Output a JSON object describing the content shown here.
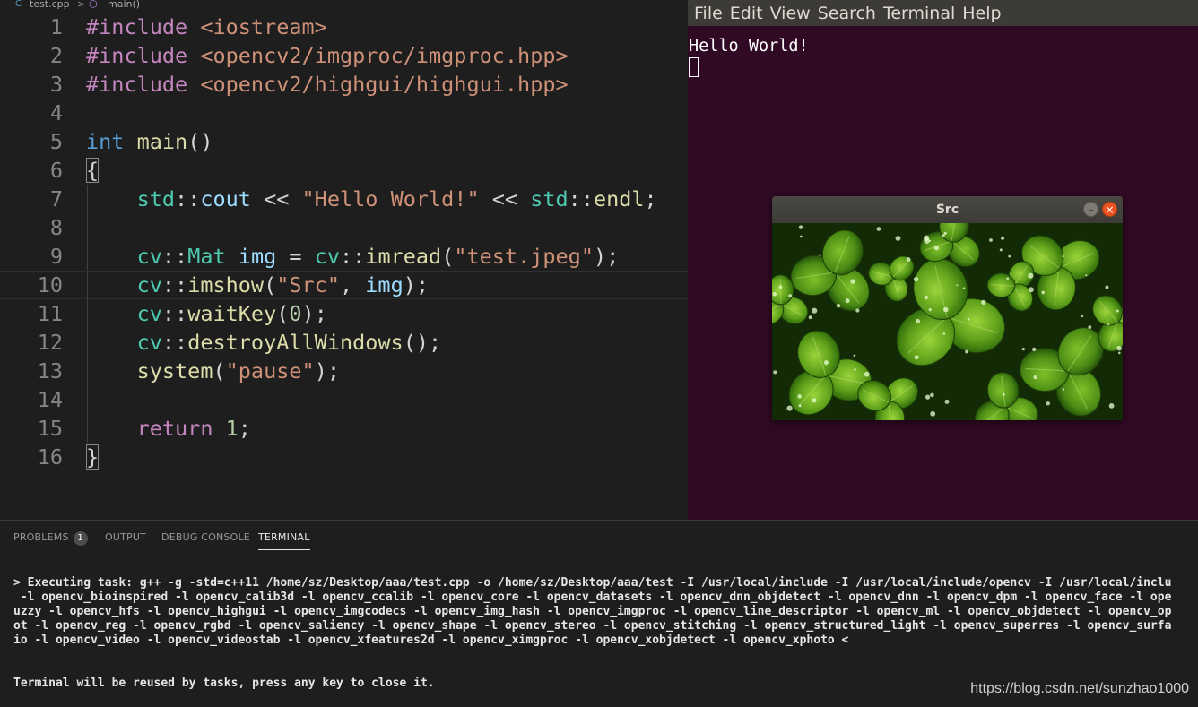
{
  "breadcrumb": {
    "file": "test.cpp",
    "separator": ">",
    "symbol": "main()"
  },
  "editor": {
    "lines": [
      {
        "n": "1",
        "tokens": [
          {
            "t": "#include",
            "c": "pp"
          },
          {
            "t": " "
          },
          {
            "t": "<iostream>",
            "c": "inc"
          }
        ]
      },
      {
        "n": "2",
        "tokens": [
          {
            "t": "#include",
            "c": "pp"
          },
          {
            "t": " "
          },
          {
            "t": "<opencv2/imgproc/imgproc.hpp>",
            "c": "inc"
          }
        ]
      },
      {
        "n": "3",
        "tokens": [
          {
            "t": "#include",
            "c": "pp"
          },
          {
            "t": " "
          },
          {
            "t": "<opencv2/highgui/highgui.hpp>",
            "c": "inc"
          }
        ]
      },
      {
        "n": "4",
        "tokens": []
      },
      {
        "n": "5",
        "tokens": [
          {
            "t": "int",
            "c": "kw"
          },
          {
            "t": " "
          },
          {
            "t": "main",
            "c": "fn"
          },
          {
            "t": "()",
            "c": "def"
          }
        ]
      },
      {
        "n": "6",
        "tokens": [
          {
            "t": "{",
            "c": "brace"
          }
        ]
      },
      {
        "n": "7",
        "tokens": [
          {
            "t": "    "
          },
          {
            "t": "std",
            "c": "ns"
          },
          {
            "t": "::",
            "c": "def"
          },
          {
            "t": "cout",
            "c": "var"
          },
          {
            "t": " << ",
            "c": "op"
          },
          {
            "t": "\"Hello World!\"",
            "c": "str"
          },
          {
            "t": " << ",
            "c": "op"
          },
          {
            "t": "std",
            "c": "ns"
          },
          {
            "t": "::",
            "c": "def"
          },
          {
            "t": "endl",
            "c": "fn"
          },
          {
            "t": ";",
            "c": "def"
          }
        ]
      },
      {
        "n": "8",
        "tokens": []
      },
      {
        "n": "9",
        "tokens": [
          {
            "t": "    "
          },
          {
            "t": "cv",
            "c": "ns"
          },
          {
            "t": "::",
            "c": "def"
          },
          {
            "t": "Mat",
            "c": "ty"
          },
          {
            "t": " "
          },
          {
            "t": "img",
            "c": "var"
          },
          {
            "t": " = ",
            "c": "op"
          },
          {
            "t": "cv",
            "c": "ns"
          },
          {
            "t": "::",
            "c": "def"
          },
          {
            "t": "imread",
            "c": "fn"
          },
          {
            "t": "(",
            "c": "def"
          },
          {
            "t": "\"test.jpeg\"",
            "c": "str"
          },
          {
            "t": ");",
            "c": "def"
          }
        ]
      },
      {
        "n": "10",
        "current": true,
        "tokens": [
          {
            "t": "    "
          },
          {
            "t": "cv",
            "c": "ns"
          },
          {
            "t": "::",
            "c": "def"
          },
          {
            "t": "imshow",
            "c": "fn"
          },
          {
            "t": "(",
            "c": "def"
          },
          {
            "t": "\"Src\"",
            "c": "str"
          },
          {
            "t": ", ",
            "c": "def"
          },
          {
            "t": "img",
            "c": "var"
          },
          {
            "t": ");",
            "c": "def"
          }
        ]
      },
      {
        "n": "11",
        "tokens": [
          {
            "t": "    "
          },
          {
            "t": "cv",
            "c": "ns"
          },
          {
            "t": "::",
            "c": "def"
          },
          {
            "t": "waitKey",
            "c": "fn"
          },
          {
            "t": "(",
            "c": "def"
          },
          {
            "t": "0",
            "c": "num"
          },
          {
            "t": ");",
            "c": "def"
          }
        ]
      },
      {
        "n": "12",
        "tokens": [
          {
            "t": "    "
          },
          {
            "t": "cv",
            "c": "ns"
          },
          {
            "t": "::",
            "c": "def"
          },
          {
            "t": "destroyAllWindows",
            "c": "fn"
          },
          {
            "t": "();",
            "c": "def"
          }
        ]
      },
      {
        "n": "13",
        "tokens": [
          {
            "t": "    "
          },
          {
            "t": "system",
            "c": "fn"
          },
          {
            "t": "(",
            "c": "def"
          },
          {
            "t": "\"pause\"",
            "c": "str"
          },
          {
            "t": ");",
            "c": "def"
          }
        ]
      },
      {
        "n": "14",
        "tokens": []
      },
      {
        "n": "15",
        "tokens": [
          {
            "t": "    "
          },
          {
            "t": "return",
            "c": "ctl"
          },
          {
            "t": " "
          },
          {
            "t": "1",
            "c": "num"
          },
          {
            "t": ";",
            "c": "def"
          }
        ]
      },
      {
        "n": "16",
        "tokens": [
          {
            "t": "}",
            "c": "brace"
          }
        ]
      }
    ]
  },
  "terminal_window": {
    "menu": [
      "File",
      "Edit",
      "View",
      "Search",
      "Terminal",
      "Help"
    ],
    "output": [
      "Hello World!"
    ]
  },
  "image_window": {
    "title": "Src",
    "minimize_glyph": "–",
    "close_glyph": "×"
  },
  "panel": {
    "tabs": [
      {
        "label": "PROBLEMS",
        "badge": "1"
      },
      {
        "label": "OUTPUT"
      },
      {
        "label": "DEBUG CONSOLE"
      },
      {
        "label": "TERMINAL",
        "active": true
      }
    ],
    "output_lines": [
      "> Executing task: g++ -g -std=c++11 /home/sz/Desktop/aaa/test.cpp -o /home/sz/Desktop/aaa/test -I /usr/local/include -I /usr/local/include/opencv -I /usr/local/inclu",
      " -l opencv_bioinspired -l opencv_calib3d -l opencv_ccalib -l opencv_core -l opencv_datasets -l opencv_dnn_objdetect -l opencv_dnn -l opencv_dpm -l opencv_face -l ope",
      "uzzy -l opencv_hfs -l opencv_highgui -l opencv_imgcodecs -l opencv_img_hash -l opencv_imgproc -l opencv_line_descriptor -l opencv_ml -l opencv_objdetect -l opencv_op",
      "ot -l opencv_reg -l opencv_rgbd -l opencv_saliency -l opencv_shape -l opencv_stereo -l opencv_stitching -l opencv_structured_light -l opencv_superres -l opencv_surfa",
      "io -l opencv_video -l opencv_videostab -l opencv_xfeatures2d -l opencv_ximgproc -l opencv_xobjdetect -l opencv_xphoto <"
    ],
    "footer_line": "Terminal will be reused by tasks, press any key to close it."
  },
  "watermark": "https://blog.csdn.net/sunzhao1000",
  "colors": {
    "editor_bg": "#1e1e1e",
    "terminal_bg": "#300a24",
    "menubar_bg": "#3c3b37",
    "close_button": "#e95420"
  }
}
